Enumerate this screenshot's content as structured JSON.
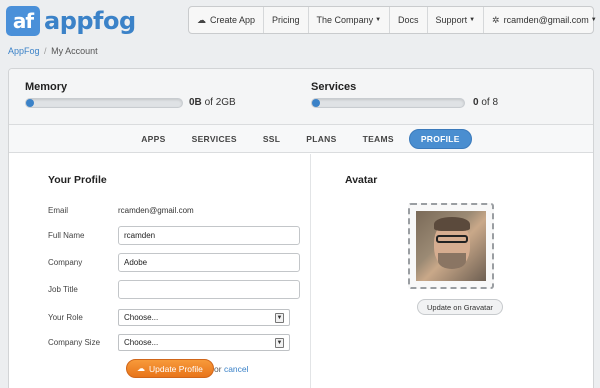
{
  "brand": {
    "logo_mark": "af",
    "name": "appfog",
    "accent": "#3b82c8"
  },
  "topnav": {
    "create_app": "Create App",
    "pricing": "Pricing",
    "company": "The Company",
    "docs": "Docs",
    "support": "Support",
    "account": "rcamden@gmail.com"
  },
  "breadcrumb": {
    "root": "AppFog",
    "sep": "/",
    "current": "My Account"
  },
  "usage": {
    "memory": {
      "title": "Memory",
      "used": "0B",
      "suffix": "of 2GB",
      "fraction": 0.0
    },
    "services": {
      "title": "Services",
      "used": "0",
      "suffix": "of 8",
      "fraction": 0.0
    }
  },
  "tabs": [
    {
      "label": "APPS",
      "active": false
    },
    {
      "label": "SERVICES",
      "active": false
    },
    {
      "label": "SSL",
      "active": false
    },
    {
      "label": "PLANS",
      "active": false
    },
    {
      "label": "TEAMS",
      "active": false
    },
    {
      "label": "PROFILE",
      "active": true
    }
  ],
  "profile": {
    "title": "Your Profile",
    "email_label": "Email",
    "email_value": "rcamden@gmail.com",
    "fullname_label": "Full Name",
    "fullname_value": "rcamden",
    "company_label": "Company",
    "company_value": "Adobe",
    "jobtitle_label": "Job Title",
    "jobtitle_value": "",
    "role_label": "Your Role",
    "role_value": "Choose...",
    "size_label": "Company Size",
    "size_value": "Choose...",
    "update_label": "Update Profile",
    "or_text": "or",
    "cancel_label": "cancel"
  },
  "avatar": {
    "title": "Avatar",
    "gravatar_button": "Update on Gravatar"
  }
}
